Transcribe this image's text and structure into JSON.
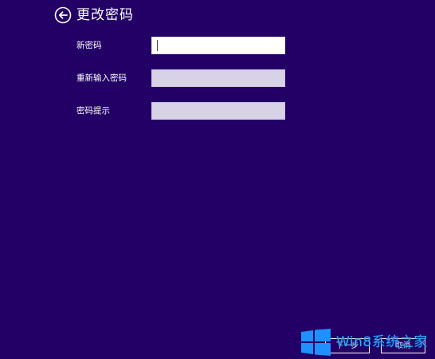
{
  "header": {
    "title": "更改密码",
    "back_icon": "back-arrow-circle-icon"
  },
  "form": {
    "fields": [
      {
        "label": "新密码",
        "value": "",
        "state": "focused"
      },
      {
        "label": "重新输入密码",
        "value": "",
        "state": "disabled"
      },
      {
        "label": "密码提示",
        "value": "",
        "state": "disabled"
      }
    ]
  },
  "footer": {
    "next_label": "下一步",
    "cancel_label": "取消"
  },
  "watermark": {
    "text": "Win8系统之家",
    "logo_icon": "windows-logo-icon"
  },
  "colors": {
    "background": "#230066",
    "text": "#ffffff",
    "input_active": "#ffffff",
    "input_disabled": "#d7d2e6",
    "watermark": "#2fa8ff"
  }
}
